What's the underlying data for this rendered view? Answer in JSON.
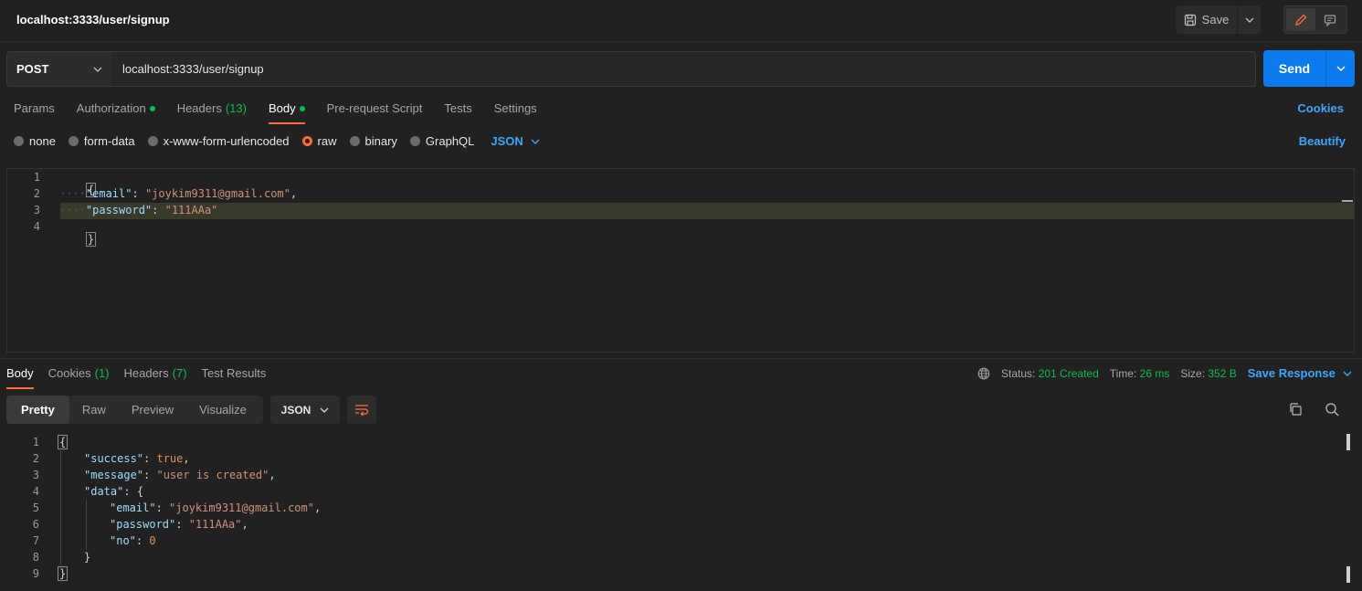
{
  "request": {
    "title": "localhost:3333/user/signup",
    "save_label": "Save",
    "method": "POST",
    "url": "localhost:3333/user/signup",
    "send_label": "Send",
    "tabs": [
      {
        "label": "Params",
        "count": "",
        "dot": false,
        "active": false
      },
      {
        "label": "Authorization",
        "count": "",
        "dot": true,
        "active": false
      },
      {
        "label": "Headers",
        "count": "(13)",
        "dot": false,
        "active": false
      },
      {
        "label": "Body",
        "count": "",
        "dot": true,
        "active": true
      },
      {
        "label": "Pre-request Script",
        "count": "",
        "dot": false,
        "active": false
      },
      {
        "label": "Tests",
        "count": "",
        "dot": false,
        "active": false
      },
      {
        "label": "Settings",
        "count": "",
        "dot": false,
        "active": false
      }
    ],
    "cookies_link": "Cookies",
    "body_types": [
      {
        "label": "none",
        "selected": false
      },
      {
        "label": "form-data",
        "selected": false
      },
      {
        "label": "x-www-form-urlencoded",
        "selected": false
      },
      {
        "label": "raw",
        "selected": true
      },
      {
        "label": "binary",
        "selected": false
      },
      {
        "label": "GraphQL",
        "selected": false
      }
    ],
    "body_format": "JSON",
    "beautify_label": "Beautify",
    "body_lines": [
      {
        "n": "1",
        "open": "{"
      },
      {
        "n": "2",
        "key": "\"email\"",
        "value": "\"joykim9311@gmail.com\"",
        "trail": ","
      },
      {
        "n": "3",
        "key": "\"password\"",
        "value": "\"111AAa\"",
        "trail": ""
      },
      {
        "n": "4",
        "close": "}"
      }
    ]
  },
  "response": {
    "tabs": [
      {
        "label": "Body",
        "count": "",
        "active": true
      },
      {
        "label": "Cookies",
        "count": "(1)",
        "active": false
      },
      {
        "label": "Headers",
        "count": "(7)",
        "active": false
      },
      {
        "label": "Test Results",
        "count": "",
        "active": false
      }
    ],
    "status_label": "Status:",
    "status_value": "201 Created",
    "time_label": "Time:",
    "time_value": "26 ms",
    "size_label": "Size:",
    "size_value": "352 B",
    "save_response_label": "Save Response",
    "view_tabs": [
      "Pretty",
      "Raw",
      "Preview",
      "Visualize"
    ],
    "format": "JSON",
    "line_numbers": [
      "1",
      "2",
      "3",
      "4",
      "5",
      "6",
      "7",
      "8",
      "9"
    ],
    "body": {
      "success_key": "\"success\"",
      "success_value": "true",
      "message_key": "\"message\"",
      "message_value": "\"user is created\"",
      "data_key": "\"data\"",
      "email_key": "\"email\"",
      "email_value": "\"joykim9311@gmail.com\"",
      "password_key": "\"password\"",
      "password_value": "\"111AAa\"",
      "no_key": "\"no\"",
      "no_value": "0"
    }
  },
  "colors": {
    "accent": "#ff6c37",
    "link": "#3ea6ff",
    "send": "#097bed",
    "success": "#0cbb52"
  }
}
